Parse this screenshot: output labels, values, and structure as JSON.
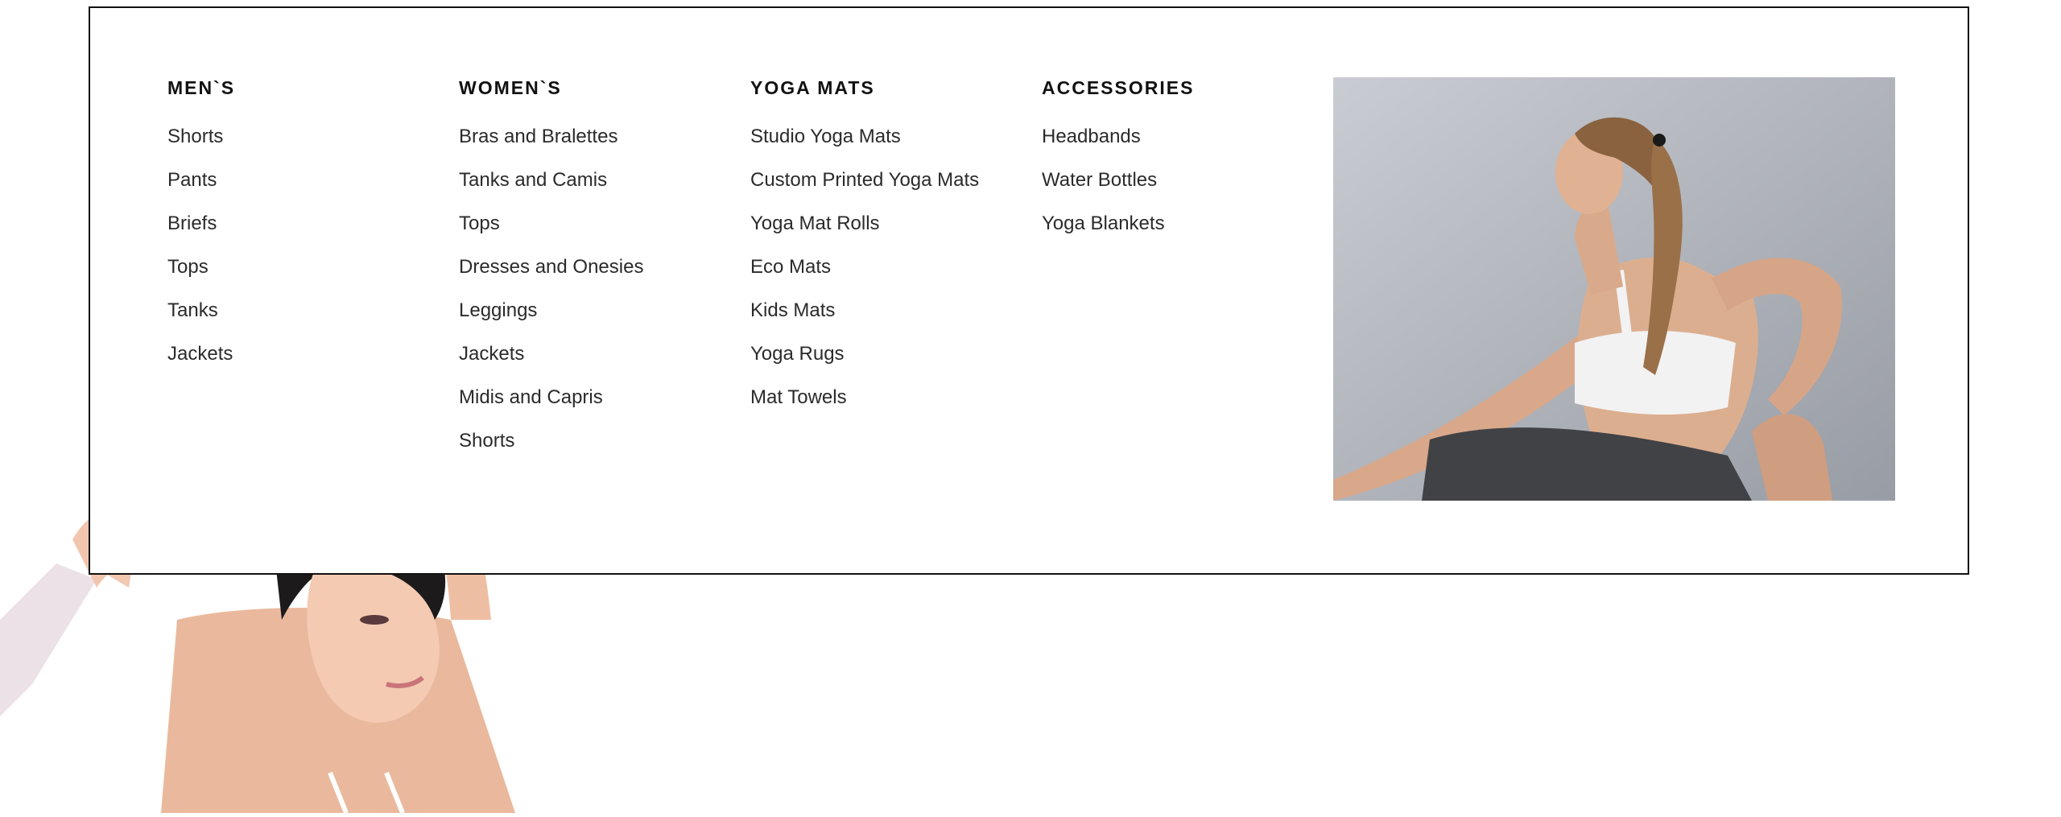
{
  "mega_menu": {
    "columns": [
      {
        "heading": "MEN`S",
        "items": [
          "Shorts",
          "Pants",
          "Briefs",
          "Tops",
          "Tanks",
          "Jackets"
        ]
      },
      {
        "heading": "WOMEN`S",
        "items": [
          "Bras and Bralettes",
          "Tanks and Camis",
          "Tops",
          "Dresses and Onesies",
          "Leggings",
          "Jackets",
          "Midis and Capris",
          "Shorts"
        ]
      },
      {
        "heading": "YOGA MATS",
        "items": [
          "Studio Yoga Mats",
          "Custom Printed Yoga Mats",
          "Yoga Mat Rolls",
          "Eco Mats",
          "Kids Mats",
          "Yoga Rugs",
          "Mat Towels"
        ]
      },
      {
        "heading": "ACCESSORIES",
        "items": [
          "Headbands",
          "Water Bottles",
          "Yoga Blankets"
        ]
      }
    ],
    "feature_image": {
      "icon": "yoga-pose-photo",
      "background": "#a9adb5"
    },
    "border_color": "#111111"
  },
  "page": {
    "background": "#ffffff",
    "hero_image_icon": "yoga-stretch-photo"
  }
}
